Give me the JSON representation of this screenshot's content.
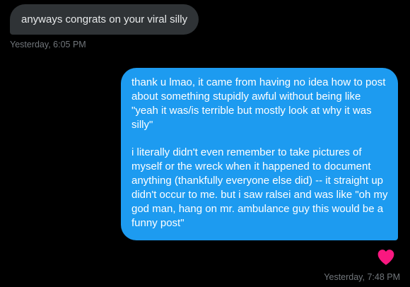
{
  "conversation": {
    "received_message": {
      "text": "anyways congrats on your viral silly",
      "timestamp": "Yesterday, 6:05 PM"
    },
    "sent_message": {
      "paragraph_1": "thank u lmao, it came from having no idea how to post about something stupidly awful without being like \"yeah it was/is terrible but mostly look at why it was silly\"",
      "paragraph_2": "i literally didn't even remember to take pictures of myself or the wreck when it happened to document anything (thankfully everyone else did) -- it straight up didn't occur to me. but i saw ralsei and was like \"oh my god man, hang on mr. ambulance guy this would be a funny post\"",
      "timestamp": "Yesterday, 7:48 PM",
      "reaction_icon": "heart-icon"
    }
  },
  "colors": {
    "background": "#000000",
    "received_bubble": "#2f3336",
    "sent_bubble": "#1d9bf0",
    "timestamp": "#71767b",
    "reaction": "#f91880"
  }
}
